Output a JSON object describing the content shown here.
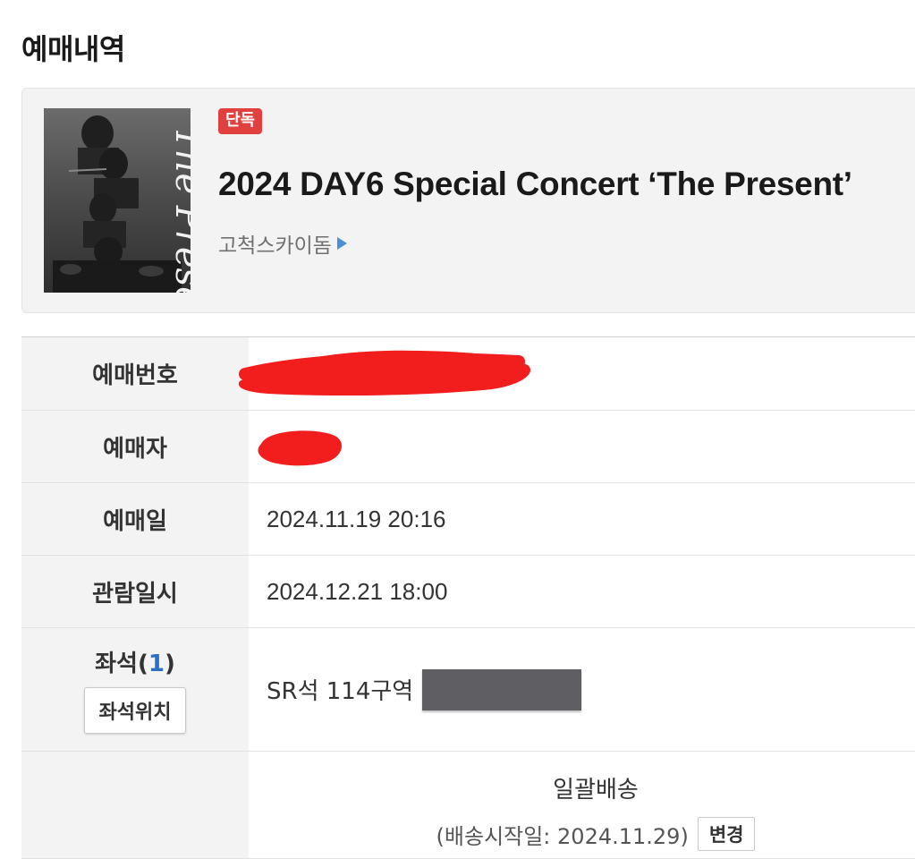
{
  "page": {
    "title": "예매내역"
  },
  "event": {
    "badge": "단독",
    "title": "2024 DAY6 Special Concert ‘The Present’",
    "venue": "고척스카이돔",
    "poster_script": "The Present"
  },
  "details": {
    "booking_number_label": "예매번호",
    "booker_label": "예매자",
    "booking_date_label": "예매일",
    "booking_date": "2024.11.19 20:16",
    "viewing_datetime_label": "관람일시",
    "viewing_datetime": "2024.12.21 18:00",
    "seat_label": "좌석(",
    "seat_count": "1",
    "seat_label_close": ")",
    "seat_location_button": "좌석위치",
    "seat_value": "SR석 114구역",
    "delivery_method": "일괄배송",
    "delivery_start": "(배송시작일: 2024.11.29)",
    "change_button": "변경"
  },
  "colors": {
    "badge": "#e0413e",
    "accent_blue": "#2a6fc9",
    "redaction_red": "#f21d1d",
    "redaction_gray": "#5f5f63"
  }
}
